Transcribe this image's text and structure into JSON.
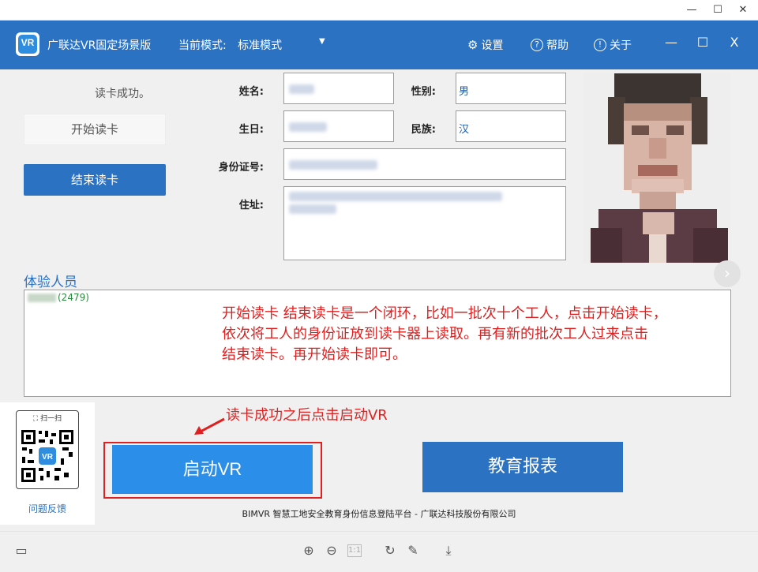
{
  "window": {
    "minimize": "—",
    "maximize": "☐",
    "close": "✕"
  },
  "app": {
    "logo": "VR",
    "title": "广联达VR固定场景版",
    "mode_label": "当前模式:",
    "mode_value": "标准模式",
    "menu": [
      {
        "icon": "gear-icon",
        "glyph": "⚙",
        "label": "设置"
      },
      {
        "icon": "help-icon",
        "glyph": "?",
        "label": "帮助"
      },
      {
        "icon": "info-icon",
        "glyph": "!",
        "label": "关于"
      }
    ],
    "buttons": {
      "minimize": "—",
      "maximize": "☐",
      "close": "X"
    }
  },
  "reader": {
    "status": "读卡成功。",
    "start_label": "开始读卡",
    "end_label": "结束读卡"
  },
  "fields": {
    "name_label": "姓名:",
    "gender_label": "性别:",
    "gender_value": "男",
    "birth_label": "生日:",
    "ethnicity_label": "民族:",
    "ethnicity_value": "汉",
    "id_label": "身份证号:",
    "address_label": "住址:"
  },
  "people": {
    "title": "体验人员",
    "entry_suffix": "(2479)"
  },
  "notes": {
    "lines": [
      "开始读卡  结束读卡是一个闭环，比如一批次十个工人，点击开始读卡，",
      "依次将工人的身份证放到读卡器上读取。再有新的批次工人过来点击",
      "结束读卡。再开始读卡即可。"
    ],
    "arrow_note": "读卡成功之后点击启动VR"
  },
  "qr": {
    "scan_label": "扫一扫",
    "feedback": "问题反馈"
  },
  "actions": {
    "launch_vr": "启动VR",
    "report": "教育报表"
  },
  "footer": "BIMVR 智慧工地安全教育身份信息登陆平台 - 广联达科技股份有限公司",
  "colors": {
    "brand": "#2b72c3",
    "accent": "#2b8ee8",
    "annotation": "#e02020"
  }
}
